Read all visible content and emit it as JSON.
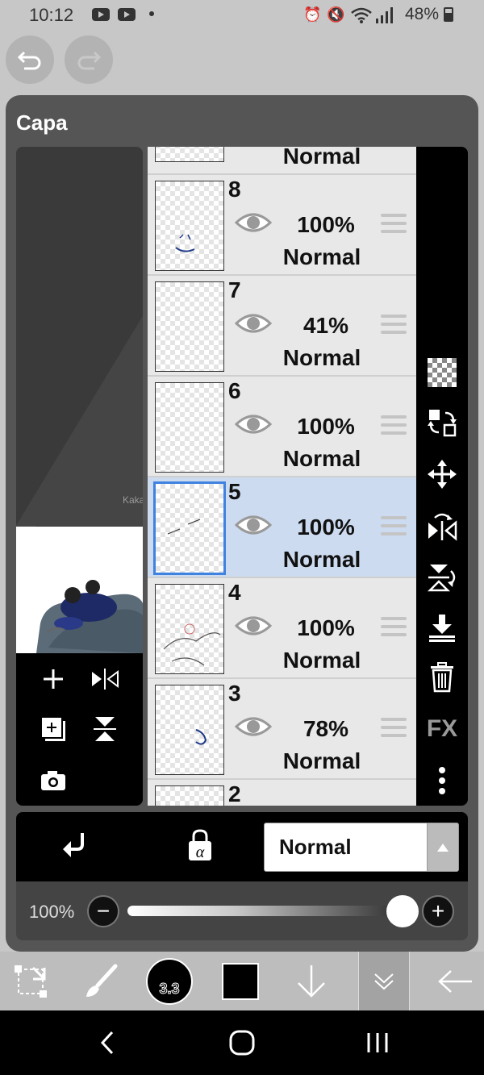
{
  "status_bar": {
    "time": "10:12",
    "battery": "48%",
    "icons": [
      "youtube-icon",
      "youtube-icon",
      "notification-dot",
      "alarm-icon",
      "mute-icon",
      "wifi-icon",
      "signal-icon",
      "battery-icon"
    ]
  },
  "top_buttons": [
    "undo-icon",
    "redo-icon"
  ],
  "panel": {
    "title": "Capa",
    "accent": "#3f82e0",
    "selected_bg": "#cddbf0"
  },
  "layers": [
    {
      "number": "",
      "opacity": "",
      "mode": "Normal",
      "visible": true,
      "selected": false
    },
    {
      "number": "8",
      "opacity": "100%",
      "mode": "Normal",
      "visible": true,
      "selected": false
    },
    {
      "number": "7",
      "opacity": "41%",
      "mode": "Normal",
      "visible": true,
      "selected": false
    },
    {
      "number": "6",
      "opacity": "100%",
      "mode": "Normal",
      "visible": true,
      "selected": false
    },
    {
      "number": "5",
      "opacity": "100%",
      "mode": "Normal",
      "visible": true,
      "selected": true
    },
    {
      "number": "4",
      "opacity": "100%",
      "mode": "Normal",
      "visible": true,
      "selected": false
    },
    {
      "number": "3",
      "opacity": "78%",
      "mode": "Normal",
      "visible": true,
      "selected": false
    },
    {
      "number": "2",
      "opacity": "",
      "mode": "",
      "visible": true,
      "selected": false
    }
  ],
  "preview_controls": [
    "add-layer-icon",
    "flip-horizontal-icon",
    "duplicate-layer-icon",
    "flip-vertical-icon",
    "camera-icon"
  ],
  "preview_sketch_text": "Kaka",
  "sidebar_tools": [
    "transparency-icon",
    "move-layer-icon",
    "move-icon",
    "flip-icon",
    "rotate-flip-icon",
    "merge-down-icon",
    "delete-icon",
    "fx-icon",
    "more-icon"
  ],
  "sidebar_fx_label": "FX",
  "blend": {
    "mode": "Normal",
    "left_icons": [
      "clipping-icon",
      "alpha-lock-icon"
    ],
    "alpha_label": "α"
  },
  "opacity": {
    "label": "100%",
    "value": 1.0,
    "minus": "−",
    "plus": "+"
  },
  "bottom_toolbar": {
    "brush_size": "3.3",
    "color": "#000000",
    "tools": [
      "transform-icon",
      "brush-icon",
      "brush-size-icon",
      "color-swatch",
      "arrow-down-icon",
      "layers-collapse-icon",
      "back-arrow-icon"
    ]
  },
  "nav_bar": [
    "back-nav-icon",
    "home-nav-icon",
    "recents-nav-icon"
  ]
}
